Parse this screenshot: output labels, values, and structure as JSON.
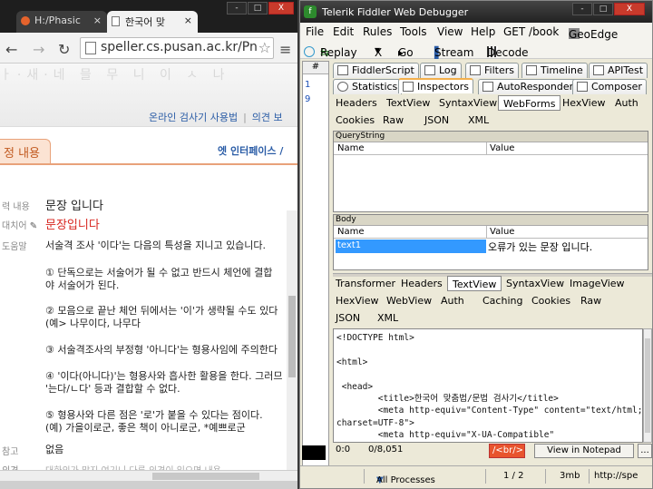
{
  "chrome": {
    "tabs": [
      {
        "label": "H:/Phasic",
        "active": false
      },
      {
        "label": "한국어 맞",
        "active": true
      }
    ],
    "window_controls": [
      "-",
      "□",
      "X"
    ],
    "url": "speller.cs.pusan.ac.kr/Pn",
    "banner_deco": "ㅏ·새·네 믈 무 니 이 ㅅ 나",
    "links": [
      "온라인 검사기 사용법",
      "의견 보"
    ],
    "result_tab": "정 내용",
    "interface_link": "엣 인터페이스 /",
    "labels": {
      "input": "력 내용",
      "replace": "대치어",
      "help": "도움말",
      "note": "참고",
      "example": "의견"
    },
    "input_text": "문장 입니다",
    "replace_text": "문장입니다",
    "help_lines": [
      "서술격 조사 '이다'는 다음의 특성을 지니고 있습니다.",
      " ① 단독으로는 서술어가 될 수 없고 반드시 체언에 결합",
      "야 서술어가 된다.",
      " ② 모음으로 끝난 체언 뒤에서는 '이'가 생략될 수도 있다",
      "   (예> 나무이다, 나무다",
      " ③ 서술격조사의 부정형 '아니다'는 형용사임에 주의한다",
      " ④ '이다(아니다)'는 형용사와 흡사한 활용을 한다. 그러므",
      "'는다/ㄴ다' 등과 결합할 수 없다.",
      " ⑤ 형용사와 다른 점은 '로'가 붙을 수 있다는 점이다.",
      "   (예) 가을이로군, 좋은 책이 아니로군, *예쁘로군"
    ],
    "note_value": "없음",
    "example_value": "대화의가 많지 여기니 다른 의견이 있으면 내용"
  },
  "fiddler": {
    "title": "Telerik Fiddler Web Debugger",
    "window_controls": [
      "-",
      "□",
      "X"
    ],
    "menu": [
      "File",
      "Edit",
      "Rules",
      "Tools",
      "View",
      "Help",
      "GET /book",
      "GeoEdge"
    ],
    "toolbar": {
      "replay": "Replay",
      "remove": "X",
      "go": "Go",
      "stream": "Stream",
      "decode": "Decode"
    },
    "session_header": "#",
    "sessions": [
      "1",
      "9"
    ],
    "top_tabs_row1": [
      "FiddlerScript",
      "Log",
      "Filters",
      "Timeline",
      "APITest"
    ],
    "top_tabs_row2": [
      "Statistics",
      "Inspectors",
      "AutoResponder",
      "Composer"
    ],
    "request_tabs_row1": [
      "Headers",
      "TextView",
      "SyntaxView",
      "WebForms",
      "HexView",
      "Auth"
    ],
    "request_tabs_row2": [
      "Cookies",
      "Raw",
      "JSON",
      "XML"
    ],
    "querystring": {
      "title": "QueryString",
      "col_name": "Name",
      "col_value": "Value"
    },
    "body": {
      "title": "Body",
      "col_name": "Name",
      "col_value": "Value",
      "row_name": "text1",
      "row_value": "오류가 있는 문장 입니다."
    },
    "response_tabs_row1": [
      "Transformer",
      "Headers",
      "TextView",
      "SyntaxView",
      "ImageView"
    ],
    "response_tabs_row2": [
      "HexView",
      "WebView",
      "Auth",
      "Caching",
      "Cookies",
      "Raw"
    ],
    "response_tabs_row3": [
      "JSON",
      "XML"
    ],
    "code_lines": [
      "<!DOCTYPE html>",
      "",
      "<html>",
      "",
      " <head>",
      "        <title>한국어 맞춤법/문법 검사기</title>",
      "        <meta http-equiv=\"Content-Type\" content=\"text/html;",
      "charset=UTF-8\">",
      "        <meta http-equiv=\"X-UA-Compatible\""
    ],
    "findbar": {
      "pos": "0:0",
      "count": "0/8,051",
      "tag": "/<br/>",
      "button": "View in Notepad",
      "more": "..."
    },
    "status": {
      "processes": "All Processes",
      "count": "1 / 2",
      "size": "3mb",
      "url": "http://spe"
    }
  }
}
